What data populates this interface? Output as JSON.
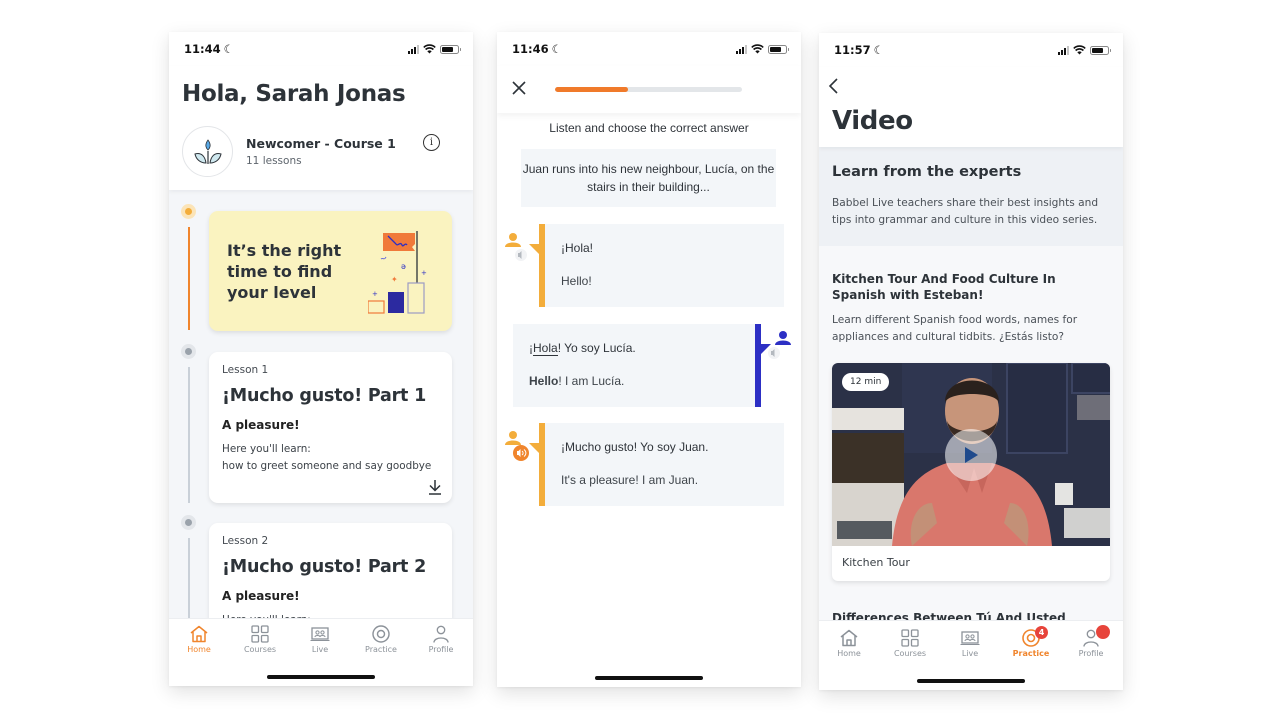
{
  "screens": {
    "home": {
      "status": {
        "time": "11:44"
      },
      "greeting": "Hola, Sarah Jonas",
      "course": {
        "name": "Newcomer - Course 1",
        "lessons": "11 lessons"
      },
      "promo": {
        "text": "It’s the right time to find your level"
      },
      "lessons": [
        {
          "number": "Lesson 1",
          "title": "¡Mucho gusto! Part 1",
          "subtitle": "A pleasure!",
          "desc_label": "Here you'll learn:",
          "desc": "how to greet someone and say goodbye"
        },
        {
          "number": "Lesson 2",
          "title": "¡Mucho gusto! Part 2",
          "subtitle": "A pleasure!",
          "desc_label": "Here you'll learn:"
        }
      ],
      "tabs": [
        {
          "label": "Home",
          "icon": "home-icon",
          "active": true
        },
        {
          "label": "Courses",
          "icon": "courses-icon"
        },
        {
          "label": "Live",
          "icon": "live-icon"
        },
        {
          "label": "Practice",
          "icon": "practice-icon"
        },
        {
          "label": "Profile",
          "icon": "profile-icon"
        }
      ]
    },
    "exercise": {
      "status": {
        "time": "11:46"
      },
      "progress_percent": 39,
      "instruction": "Listen and choose the correct answer",
      "context": "Juan runs into his new neighbour, Lucía, on the stairs in their building...",
      "dialogue": [
        {
          "speaker": "Juan",
          "side": "left",
          "spanish": "¡Hola!",
          "english": "Hello!",
          "color": "#f3ad3b"
        },
        {
          "speaker": "Lucía",
          "side": "right",
          "spanish_pre": "¡",
          "spanish_hl": "Hola",
          "spanish_post": "! Yo soy Lucía.",
          "english_bold": "Hello",
          "english_rest": "! I am Lucía.",
          "color": "#2c2fc4"
        },
        {
          "speaker": "Juan",
          "side": "left",
          "spanish": "¡Mucho gusto! Yo soy Juan.",
          "english": "It's a pleasure! I am Juan.",
          "color": "#f3ad3b",
          "playing": true
        }
      ]
    },
    "video": {
      "status": {
        "time": "11:57"
      },
      "title": "Video",
      "intro": {
        "title": "Learn from the experts",
        "desc": "Babbel Live teachers share their best insights and tips into grammar and culture in this video series."
      },
      "items": [
        {
          "title": "Kitchen Tour And Food Culture In Spanish with Esteban!",
          "desc": "Learn different Spanish food words, names for appliances and cultural tidbits.  ¿Estás listo?",
          "duration": "12 min",
          "caption": "Kitchen Tour"
        },
        {
          "title": "Differences Between Tú And Usted"
        }
      ],
      "tabs": [
        {
          "label": "Home",
          "icon": "home-icon"
        },
        {
          "label": "Courses",
          "icon": "courses-icon"
        },
        {
          "label": "Live",
          "icon": "live-icon"
        },
        {
          "label": "Practice",
          "icon": "practice-icon",
          "active": true,
          "badge": "4"
        },
        {
          "label": "Profile",
          "icon": "profile-icon",
          "dot": true
        }
      ]
    }
  },
  "colors": {
    "accent": "#f0852d",
    "juan": "#f3ad3b",
    "lucia": "#2c2fc4",
    "badge": "#e7443b"
  }
}
